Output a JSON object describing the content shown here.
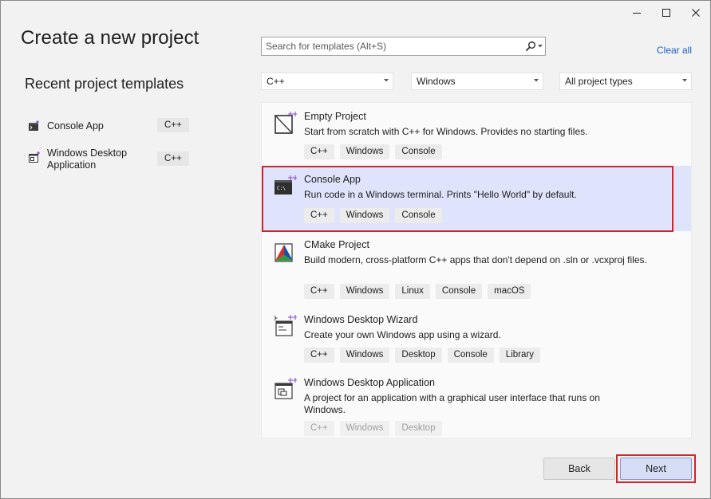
{
  "window": {
    "title": "Create a new project",
    "controls": [
      "minimize-icon",
      "maximize-icon",
      "close-icon"
    ]
  },
  "recent": {
    "heading": "Recent project templates",
    "items": [
      {
        "label": "Console App",
        "tag": "C++",
        "icon": "console-app-icon"
      },
      {
        "label": "Windows Desktop Application",
        "tag": "C++",
        "icon": "windows-desktop-app-icon"
      }
    ]
  },
  "search": {
    "placeholder": "Search for templates (Alt+S)",
    "value": ""
  },
  "clear_all": "Clear all",
  "filters": {
    "language": "C++",
    "platform": "Windows",
    "project_type": "All project types"
  },
  "templates": [
    {
      "name": "Empty Project",
      "description": "Start from scratch with C++ for Windows. Provides no starting files.",
      "tags": [
        "C++",
        "Windows",
        "Console"
      ],
      "icon": "empty-project-icon",
      "selected": false
    },
    {
      "name": "Console App",
      "description": "Run code in a Windows terminal. Prints \"Hello World\" by default.",
      "tags": [
        "C++",
        "Windows",
        "Console"
      ],
      "icon": "console-app-icon",
      "selected": true
    },
    {
      "name": "CMake Project",
      "description": "Build modern, cross-platform C++ apps that don't depend on .sln or .vcxproj files.",
      "tags": [
        "C++",
        "Windows",
        "Linux",
        "Console",
        "macOS"
      ],
      "icon": "cmake-icon",
      "selected": false
    },
    {
      "name": "Windows Desktop Wizard",
      "description": "Create your own Windows app using a wizard.",
      "tags": [
        "C++",
        "Windows",
        "Desktop",
        "Console",
        "Library"
      ],
      "icon": "wizard-icon",
      "selected": false
    },
    {
      "name": "Windows Desktop Application",
      "description": "A project for an application with a graphical user interface that runs on Windows.",
      "tags": [
        "C++",
        "Windows",
        "Desktop"
      ],
      "icon": "windows-desktop-app-icon",
      "selected": false
    }
  ],
  "buttons": {
    "back": "Back",
    "next": "Next"
  },
  "colors": {
    "selection_bg": "#dfe3fb",
    "highlight_outline": "#d4222b",
    "link": "#1f5fbf",
    "primary_button": "#d6ddf6"
  }
}
